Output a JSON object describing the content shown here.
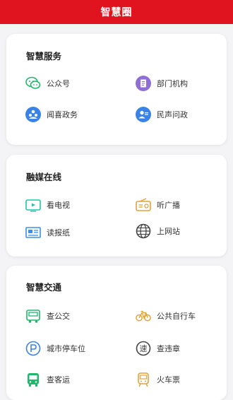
{
  "header": {
    "title": "智慧圈"
  },
  "sections": [
    {
      "title": "智慧服务",
      "items": [
        {
          "label": "公众号",
          "icon": "wechat-icon"
        },
        {
          "label": "部门机构",
          "icon": "document-icon"
        },
        {
          "label": "闻喜政务",
          "icon": "government-icon"
        },
        {
          "label": "民声问政",
          "icon": "petition-icon"
        }
      ]
    },
    {
      "title": "融媒在线",
      "items": [
        {
          "label": "看电视",
          "icon": "tv-icon"
        },
        {
          "label": "听广播",
          "icon": "radio-icon"
        },
        {
          "label": "读报纸",
          "icon": "newspaper-icon"
        },
        {
          "label": "上网站",
          "icon": "globe-icon"
        }
      ]
    },
    {
      "title": "智慧交通",
      "items": [
        {
          "label": "查公交",
          "icon": "bus-icon"
        },
        {
          "label": "公共自行车",
          "icon": "bicycle-icon"
        },
        {
          "label": "城市停车位",
          "icon": "parking-icon"
        },
        {
          "label": "查违章",
          "icon": "violation-icon"
        },
        {
          "label": "查客运",
          "icon": "coach-icon"
        },
        {
          "label": "火车票",
          "icon": "train-icon"
        }
      ]
    }
  ]
}
